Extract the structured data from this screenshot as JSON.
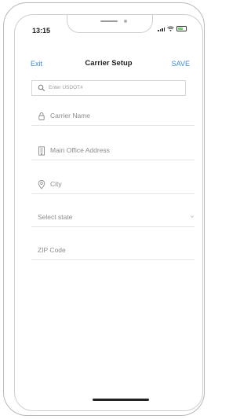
{
  "status_bar": {
    "time": "13:15"
  },
  "header": {
    "exit_label": "Exit",
    "title": "Carrier Setup",
    "save_label": "SAVE"
  },
  "search": {
    "placeholder": "Enter USDOT#"
  },
  "form": {
    "carrier_name": "Carrier Name",
    "main_office_address": "Main Office Address",
    "city": "City",
    "state": "Select state",
    "zip": "ZIP Code"
  },
  "colors": {
    "accent": "#3d8ad4",
    "text": "#222222",
    "placeholder": "#8c8c8c"
  },
  "icons": {
    "search": "search-icon",
    "carrier": "lock-icon",
    "address": "building-icon",
    "city": "location-pin-icon",
    "state": "chevron-down-icon"
  }
}
